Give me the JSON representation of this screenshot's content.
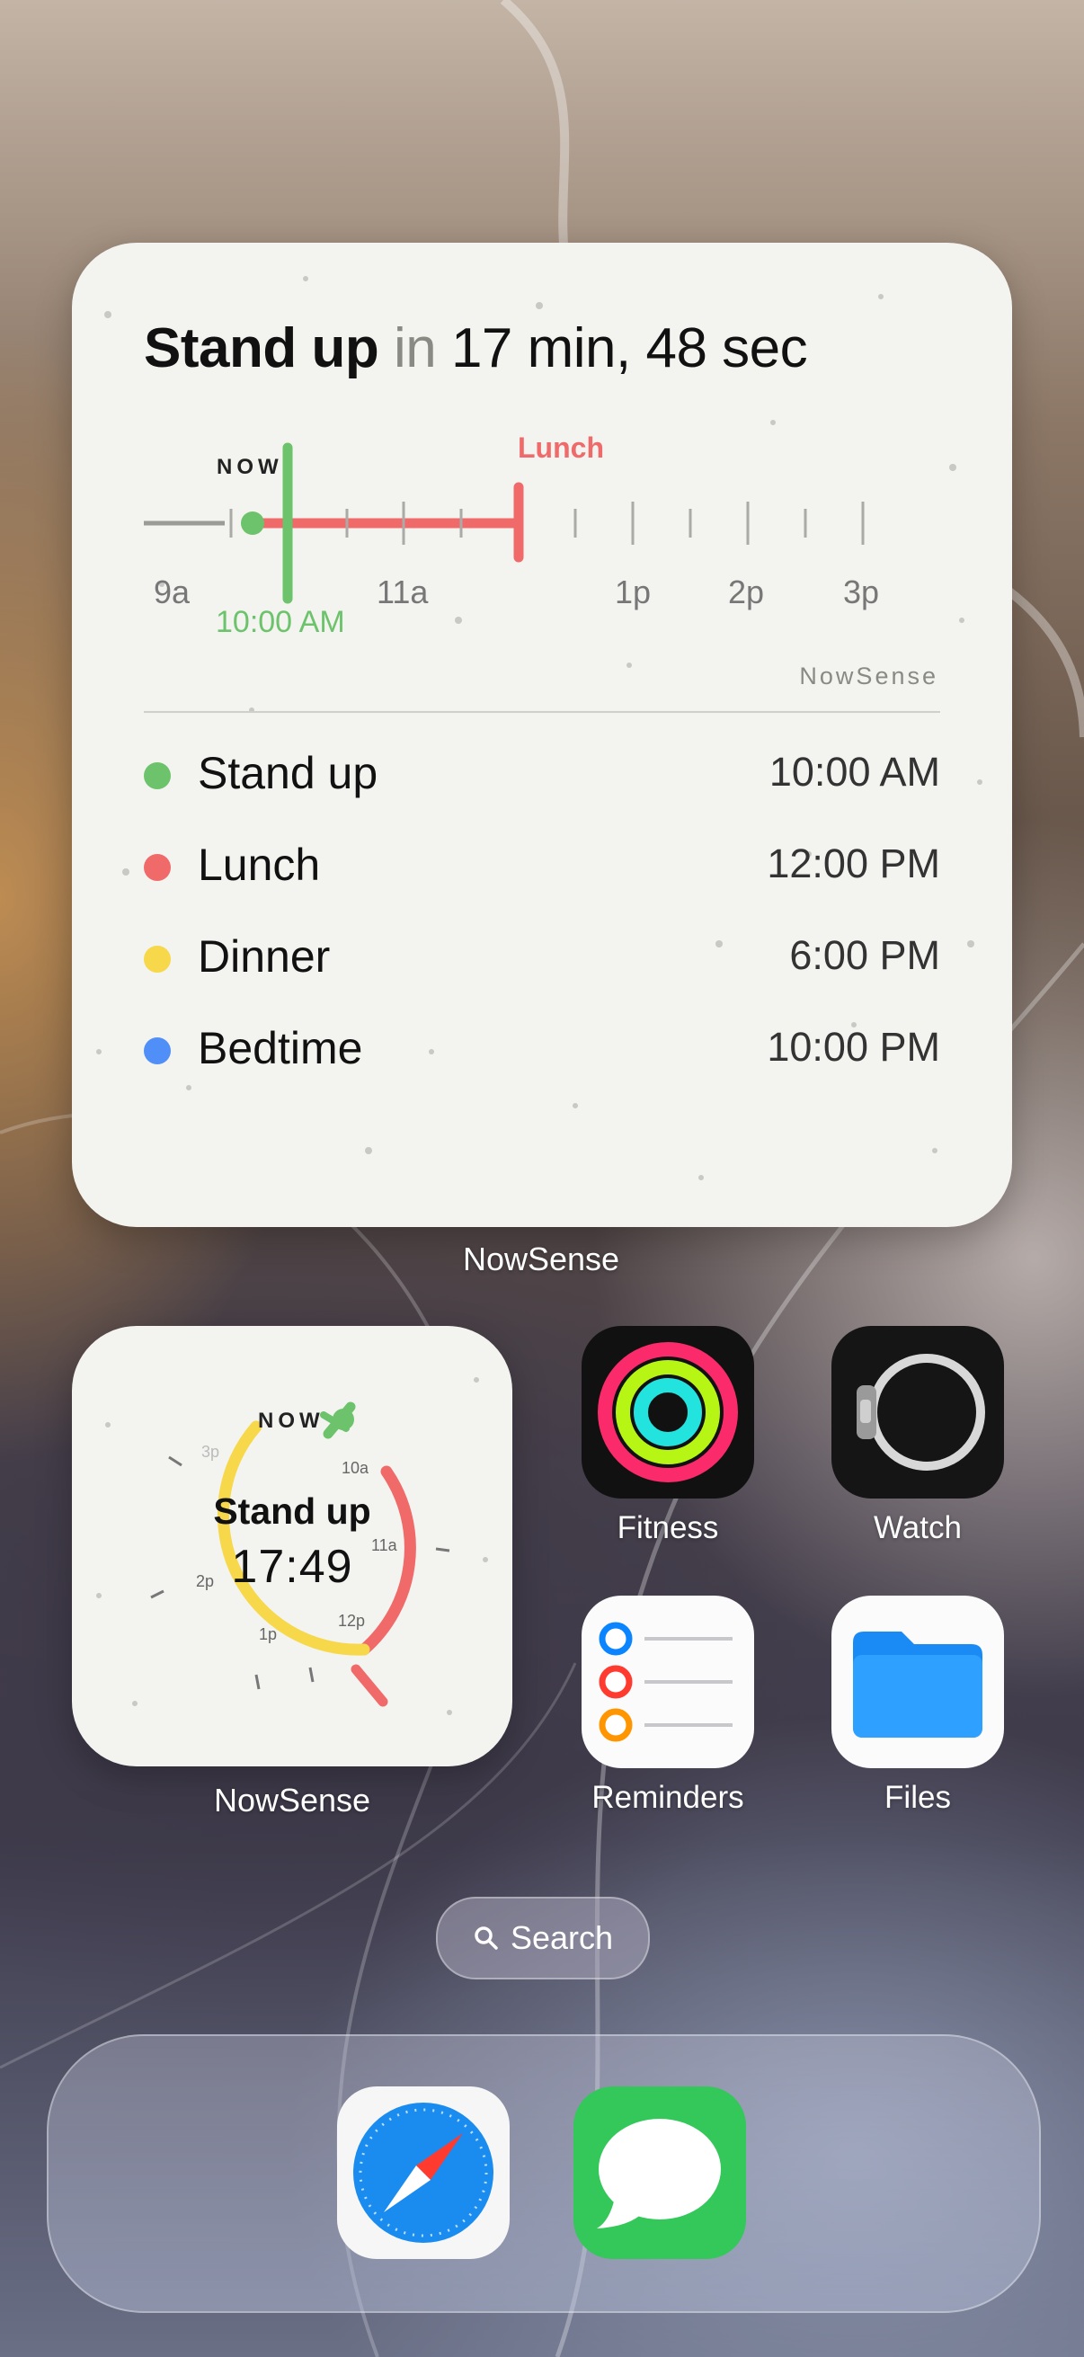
{
  "big_widget": {
    "headline_event": "Stand up",
    "headline_in": "in",
    "headline_countdown": "17 min, 48 sec",
    "now_label": "NOW",
    "now_time": "10:00 AM",
    "marker_label": "Lunch",
    "hour_labels": [
      "9a",
      "11a",
      "1p",
      "2p",
      "3p"
    ],
    "brand": "NowSense",
    "events": [
      {
        "name": "Stand up",
        "time": "10:00 AM",
        "color": "#6cc36c"
      },
      {
        "name": "Lunch",
        "time": "12:00 PM",
        "color": "#f06a6a"
      },
      {
        "name": "Dinner",
        "time": "6:00 PM",
        "color": "#f7d84a"
      },
      {
        "name": "Bedtime",
        "time": "10:00 PM",
        "color": "#4f8ff7"
      }
    ],
    "caption": "NowSense"
  },
  "small_widget": {
    "now_label": "NOW",
    "title": "Stand up",
    "countdown": "17:49",
    "ticks": [
      "10a",
      "11a",
      "12p",
      "1p",
      "2p",
      "3p"
    ],
    "caption": "NowSense"
  },
  "apps": [
    {
      "label": "Fitness",
      "icon": "fitness-rings-icon"
    },
    {
      "label": "Watch",
      "icon": "watch-icon"
    },
    {
      "label": "Reminders",
      "icon": "reminders-list-icon"
    },
    {
      "label": "Files",
      "icon": "folder-icon"
    }
  ],
  "search": {
    "label": "Search",
    "icon": "magnifier-icon"
  },
  "dock": [
    {
      "icon": "safari-compass-icon"
    },
    {
      "icon": "messages-bubble-icon"
    }
  ]
}
